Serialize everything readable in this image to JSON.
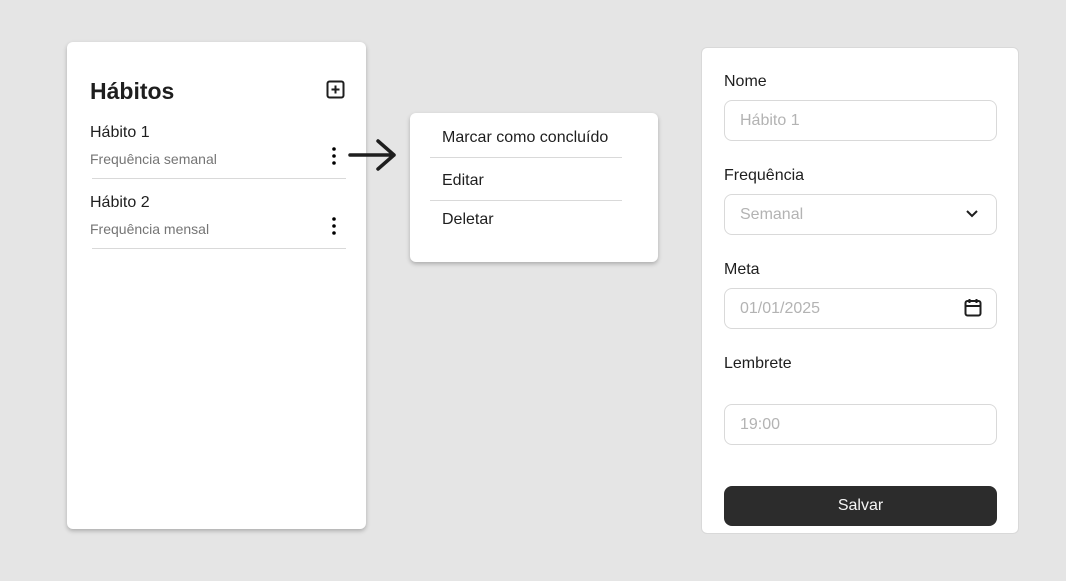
{
  "list": {
    "title": "Hábitos",
    "add_icon": "plus-square-icon",
    "items": [
      {
        "name": "Hábito 1",
        "frequency": "Frequência semanal"
      },
      {
        "name": "Hábito 2",
        "frequency": "Frequência mensal"
      }
    ]
  },
  "menu": {
    "items": [
      "Marcar como concluído",
      "Editar",
      "Deletar"
    ]
  },
  "form": {
    "name_label": "Nome",
    "name_placeholder": "Hábito 1",
    "frequency_label": "Frequência",
    "frequency_value": "Semanal",
    "goal_label": "Meta",
    "goal_placeholder": "01/01/2025",
    "reminder_label": "Lembrete",
    "reminder_placeholder": "19:00",
    "save_label": "Salvar"
  }
}
